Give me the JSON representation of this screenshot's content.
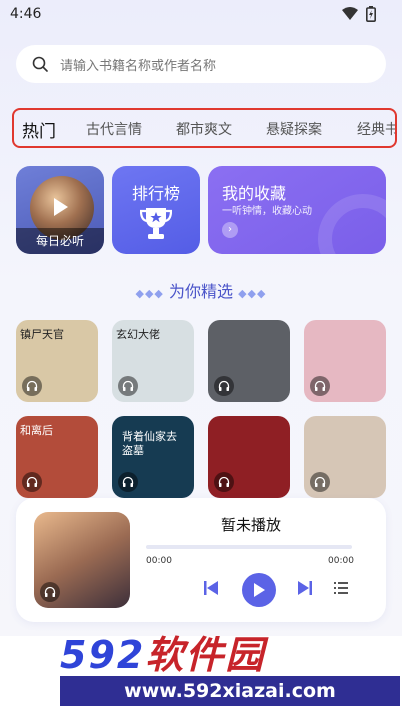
{
  "status": {
    "time": "4:46"
  },
  "search": {
    "placeholder": "请输入书籍名称或作者名称"
  },
  "tabs": [
    {
      "label": "热门",
      "active": true
    },
    {
      "label": "古代言情"
    },
    {
      "label": "都市爽文"
    },
    {
      "label": "悬疑探案"
    },
    {
      "label": "经典书"
    }
  ],
  "cards": {
    "daily": {
      "label": "每日必听"
    },
    "rank": {
      "label": "排行榜"
    },
    "fav": {
      "title": "我的收藏",
      "subtitle": "一听钟情，收藏心动"
    }
  },
  "section": {
    "title": "为你精选",
    "left_deco": "◆◆◆",
    "right_deco": "◆◆◆"
  },
  "books": [
    {
      "cover_text": "镇尸天官",
      "bg": "#d9c8a6"
    },
    {
      "cover_text": "玄幻大佬",
      "bg": "#d7dfe2"
    },
    {
      "cover_text": "",
      "bg": "#5d6066"
    },
    {
      "cover_text": "",
      "bg": "#e6b8c2"
    },
    {
      "cover_text": "和离后",
      "bg": "#b34c3a"
    },
    {
      "cover_text": "背着仙家去盗墓",
      "bg": "#163b52"
    },
    {
      "cover_text": "",
      "bg": "#8f1f24"
    },
    {
      "cover_text": "",
      "bg": "#d6c6b6"
    }
  ],
  "player": {
    "title": "暂未播放",
    "time_start": "00:00",
    "time_end": "00:00",
    "progress": 0.0
  },
  "watermark": {
    "num": "592",
    "cn": "软件园",
    "url": "www.592xiazai.com"
  },
  "colors": {
    "accent": "#5b63e6",
    "tab_highlight": "#e0382f"
  }
}
